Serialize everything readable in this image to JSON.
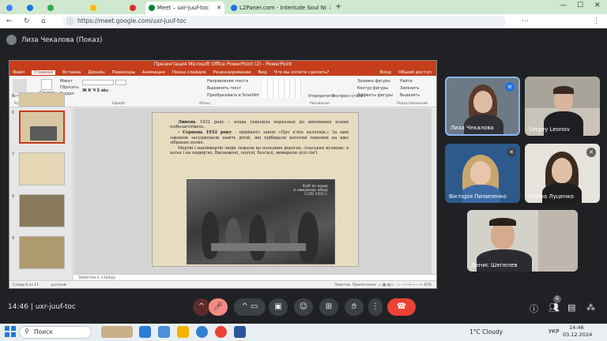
{
  "browser": {
    "tabs": [
      {
        "label": "",
        "color": "#4285f4"
      },
      {
        "label": "",
        "color": "#1a73e8"
      },
      {
        "label": "",
        "color": "#34a853"
      },
      {
        "label": "",
        "color": "#fbbc04"
      },
      {
        "label": "",
        "color": "#d93025"
      },
      {
        "label": "Meet – uxr-juuf-toc",
        "color": "#00832d"
      },
      {
        "label": "L2Paner.com - Interlude Soul Ni",
        "color": "#1a73e8"
      }
    ],
    "url": "https://meet.google.com/uxr-juuf-toc"
  },
  "meet": {
    "presenter_label": "Лиза Чекалова (Показ)",
    "time": "14:46",
    "meeting_code": "uxr-juuf-toc",
    "participants_badge": "6"
  },
  "ppt": {
    "title": "Презентация Microsoft Office PowerPoint (2) - PowerPoint",
    "menu": [
      "Файл",
      "Главная",
      "Вставка",
      "Дизайн",
      "Переходы",
      "Анимация",
      "Показ слайдов",
      "Рецензирование",
      "Вид",
      "Что вы хотите сделать?"
    ],
    "menu_right": "Вход",
    "share": "Общий доступ",
    "ribbon": {
      "paste": "Вставить",
      "create": "Создать слайд",
      "layout": "Макет",
      "reset": "Сбросить",
      "section": "Раздел",
      "text_dir": "Направление текста",
      "align_text": "Выровнять текст",
      "smartart": "Преобразовать в SmartArt",
      "arrange": "Упорядочить",
      "quick_styles": "Экспресс-стили",
      "fill": "Заливка фигуры",
      "outline": "Контур фигуры",
      "effects": "Эффекты фигуры",
      "find": "Найти",
      "replace": "Заменить",
      "select": "Выделить",
      "groups": [
        "Буфер обмена",
        "Слайды",
        "Шрифт",
        "Абзац",
        "Рисование",
        "Редактирование"
      ]
    },
    "thumb_numbers": [
      "6",
      "7",
      "8",
      "9"
    ],
    "slide": {
      "p1_bold": "Липень",
      "p1": " 1932 року – влада ухвалила нереальні до виконання плани хлібозаготівель.",
      "p2_bold": "- Серпень 1932 року",
      "p2": " - прийнято закон «Про п'ять колосків.» За цим законом засуджували навіть дітей, які підбирали колоски пшениці на вже зібраних полях.",
      "p3": "Мертві і напівмертві люди лежали на польових дорогах, сільських вулицях, в хатах і на подвір'ях. Виснажені, опухлі, безсилі, вимирали цілі сім'ї.",
      "photo_caption": "Хліб по нормі\nк ожидному обеду\n12/XI 1932 г."
    },
    "notes": "Заметки к слайду",
    "status_left": "Слайд 6 из 11",
    "status_lang": "русский",
    "status_notes": "Заметки",
    "status_comments": "Примечания",
    "zoom": "45%"
  },
  "participants": [
    {
      "name": "Лиза Чекалова"
    },
    {
      "name": "Sergey Leonov"
    },
    {
      "name": "Вікторія Пилипенко"
    },
    {
      "name": "Олена Луценко"
    },
    {
      "name": "Денис Шепелев"
    }
  ],
  "taskbar": {
    "search_placeholder": "Поиск",
    "weather": "1°C Cloudy",
    "lang": "УКР",
    "clock_time": "14:46",
    "clock_date": "03.12.2024"
  }
}
